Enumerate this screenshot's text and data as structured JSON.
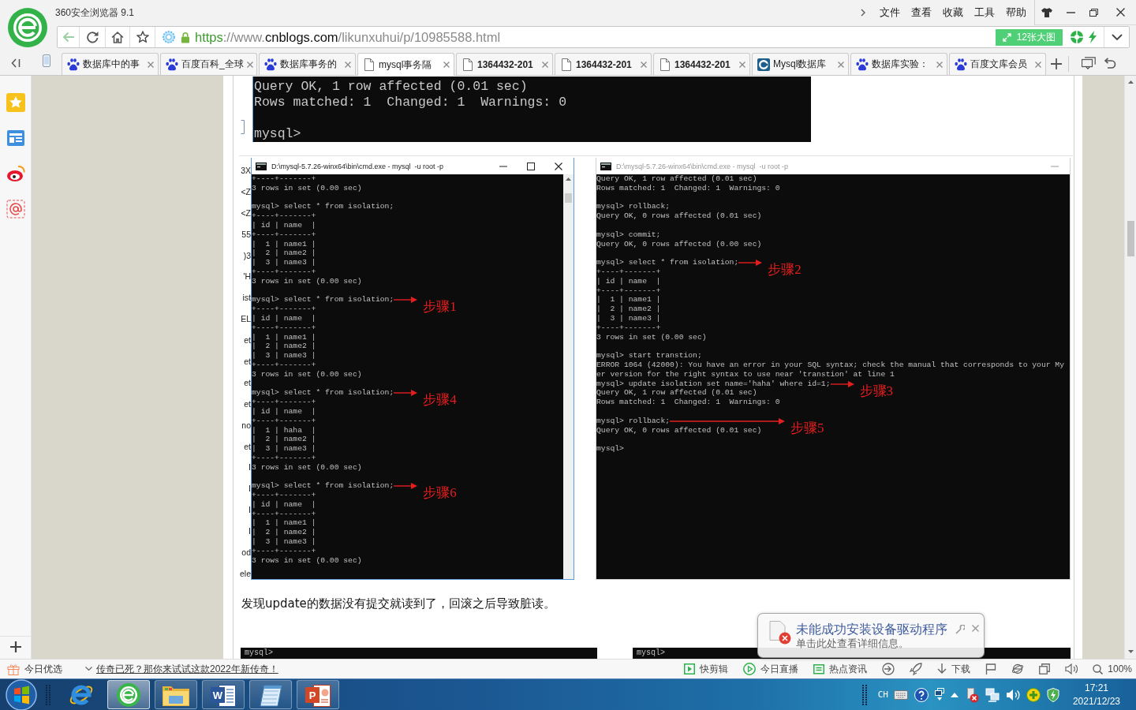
{
  "browser": {
    "title": "360安全浏览器 9.1",
    "menu": [
      "文件",
      "查看",
      "收藏",
      "工具",
      "帮助"
    ],
    "url": [
      {
        "text": "https",
        "kind": "scheme"
      },
      {
        "text": "://www.",
        "kind": "plain"
      },
      {
        "text": "cnblogs.com",
        "kind": "domain"
      },
      {
        "text": "/likunxuhui/p/10985588.html",
        "kind": "plain"
      }
    ],
    "gallery_button": "12张大图"
  },
  "tabs": [
    {
      "label": "数据库中的事",
      "kind": "paw",
      "bold": false,
      "selected": false
    },
    {
      "label": "百度百科_全球",
      "kind": "paw",
      "bold": false,
      "selected": false
    },
    {
      "label": "数据库事务的",
      "kind": "paw",
      "bold": false,
      "selected": false
    },
    {
      "label": "mysql事务隔",
      "kind": "page",
      "bold": false,
      "selected": true
    },
    {
      "label": "1364432-201",
      "kind": "page",
      "bold": true,
      "selected": false
    },
    {
      "label": "1364432-201",
      "kind": "page",
      "bold": true,
      "selected": false
    },
    {
      "label": "1364432-201",
      "kind": "page",
      "bold": true,
      "selected": false
    },
    {
      "label": "Mysql数据库",
      "kind": "ring",
      "bold": false,
      "selected": false
    },
    {
      "label": "数据库实验：",
      "kind": "paw",
      "bold": false,
      "selected": false
    },
    {
      "label": "百度文库会员",
      "kind": "paw",
      "bold": false,
      "selected": false
    }
  ],
  "page": {
    "top_terminal": {
      "blocks": [
        [
          "Query OK, 1 row affected (0.01 sec)",
          "Rows matched: 1  Changed: 1  Warnings: 0"
        ],
        [
          "mysql>"
        ]
      ]
    },
    "screenshot": {
      "behind_text": [
        "3X",
        "<Z",
        "<Z",
        "55",
        ")3",
        "'H",
        "ist",
        "EL",
        "et",
        "et",
        "et",
        "et",
        "no",
        "et",
        "I",
        "I",
        "I",
        "I",
        "od",
        "ele"
      ],
      "windows": [
        {
          "title": "D:\\mysql-5.7.26-winx64\\bin\\cmd.exe - mysql  -u root -p",
          "active": true,
          "scrollbar": true,
          "blocks": [
            [
              "+----+-------+",
              "3 rows in set (0.00 sec)"
            ],
            [
              "mysql> select * from isolation;",
              "+----+-------+",
              "| id | name  |",
              "+----+-------+",
              "|  1 | name1 |",
              "|  2 | name2 |",
              "|  3 | name3 |",
              "+----+-------+",
              "3 rows in set (0.00 sec)"
            ],
            [
              {
                "text": "mysql> select * from isolation;",
                "step": "步骤1"
              },
              "+----+-------+",
              "| id | name  |",
              "+----+-------+",
              "|  1 | name1 |",
              "|  2 | name2 |",
              "|  3 | name3 |",
              "+----+-------+",
              "3 rows in set (0.00 sec)"
            ],
            [
              {
                "text": "mysql> select * from isolation;",
                "step": "步骤4"
              },
              "+----+-------+",
              "| id | name  |",
              "+----+-------+",
              "|  1 | haha  |",
              "|  2 | name2 |",
              "|  3 | name3 |",
              "+----+-------+",
              "3 rows in set (0.00 sec)"
            ],
            [
              {
                "text": "mysql> select * from isolation;",
                "step": "步骤6"
              },
              "+----+-------+",
              "| id | name  |",
              "+----+-------+",
              "|  1 | name1 |",
              "|  2 | name2 |",
              "|  3 | name3 |",
              "+----+-------+",
              "3 rows in set (0.00 sec)"
            ]
          ]
        },
        {
          "title": "D:\\mysql-5.7.26-winx64\\bin\\cmd.exe - mysql  -u root -p",
          "active": false,
          "scrollbar": false,
          "blocks": [
            [
              "Query OK, 1 row affected (0.01 sec)",
              "Rows matched: 1  Changed: 1  Warnings: 0"
            ],
            [
              "mysql> rollback;",
              "Query OK, 0 rows affected (0.01 sec)"
            ],
            [
              "mysql> commit;",
              "Query OK, 0 rows affected (0.00 sec)"
            ],
            [
              {
                "text": "mysql> select * from isolation;",
                "step": "步骤2"
              },
              "+----+-------+",
              "| id | name  |",
              "+----+-------+",
              "|  1 | name1 |",
              "|  2 | name2 |",
              "|  3 | name3 |",
              "+----+-------+",
              "3 rows in set (0.00 sec)"
            ],
            [
              "mysql> start transtion;",
              "ERROR 1064 (42000): You have an error in your SQL syntax; check the manual that corresponds to your My",
              "er version for the right syntax to use near 'transtion' at line 1",
              {
                "text": "mysql> update isolation set name='haha' where id=1;",
                "step": "步骤3"
              },
              "Query OK, 1 row affected (0.01 sec)",
              "Rows matched: 1  Changed: 1  Warnings: 0"
            ],
            [
              {
                "text": "mysql> rollback;",
                "step": "步骤5"
              },
              "Query OK, 0 rows affected (0.01 sec)"
            ],
            [
              "mysql>"
            ]
          ]
        }
      ]
    },
    "paragraph": "发现update的数据没有提交就读到了，回滚之后导致脏读。",
    "bottom_terminals": [
      "mysql>",
      "mysql>"
    ]
  },
  "status_bar": {
    "featured": "今日优选",
    "ad_link": "传奇已死？那你来试试这款2022年新传奇！",
    "tools": [
      {
        "label": "快剪辑",
        "kind": "clip"
      },
      {
        "label": "今日直播",
        "kind": "live"
      },
      {
        "label": "热点资讯",
        "kind": "news"
      },
      {
        "kind": "speed"
      },
      {
        "kind": "rocket"
      },
      {
        "label": "下载",
        "kind": "download"
      },
      {
        "kind": "flag"
      },
      {
        "kind": "globe"
      },
      {
        "kind": "window"
      },
      {
        "kind": "volume"
      },
      {
        "label": "100%",
        "kind": "zoom"
      }
    ]
  },
  "notification": {
    "title": "未能成功安装设备驱动程序",
    "body": "单击此处查看详细信息。"
  },
  "taskbar": {
    "apps": [
      {
        "kind": "globe",
        "running": false,
        "selected": false
      },
      {
        "kind": "browser",
        "running": true,
        "selected": true
      },
      {
        "kind": "folder",
        "running": true,
        "selected": false
      },
      {
        "kind": "word",
        "letter": "W",
        "running": true,
        "selected": false
      },
      {
        "kind": "notepad",
        "running": true,
        "selected": false
      },
      {
        "kind": "slides",
        "letter": "P",
        "running": true,
        "selected": false
      }
    ],
    "tray": {
      "language": "CH",
      "time": "17:21",
      "date": "2021/12/23"
    }
  }
}
